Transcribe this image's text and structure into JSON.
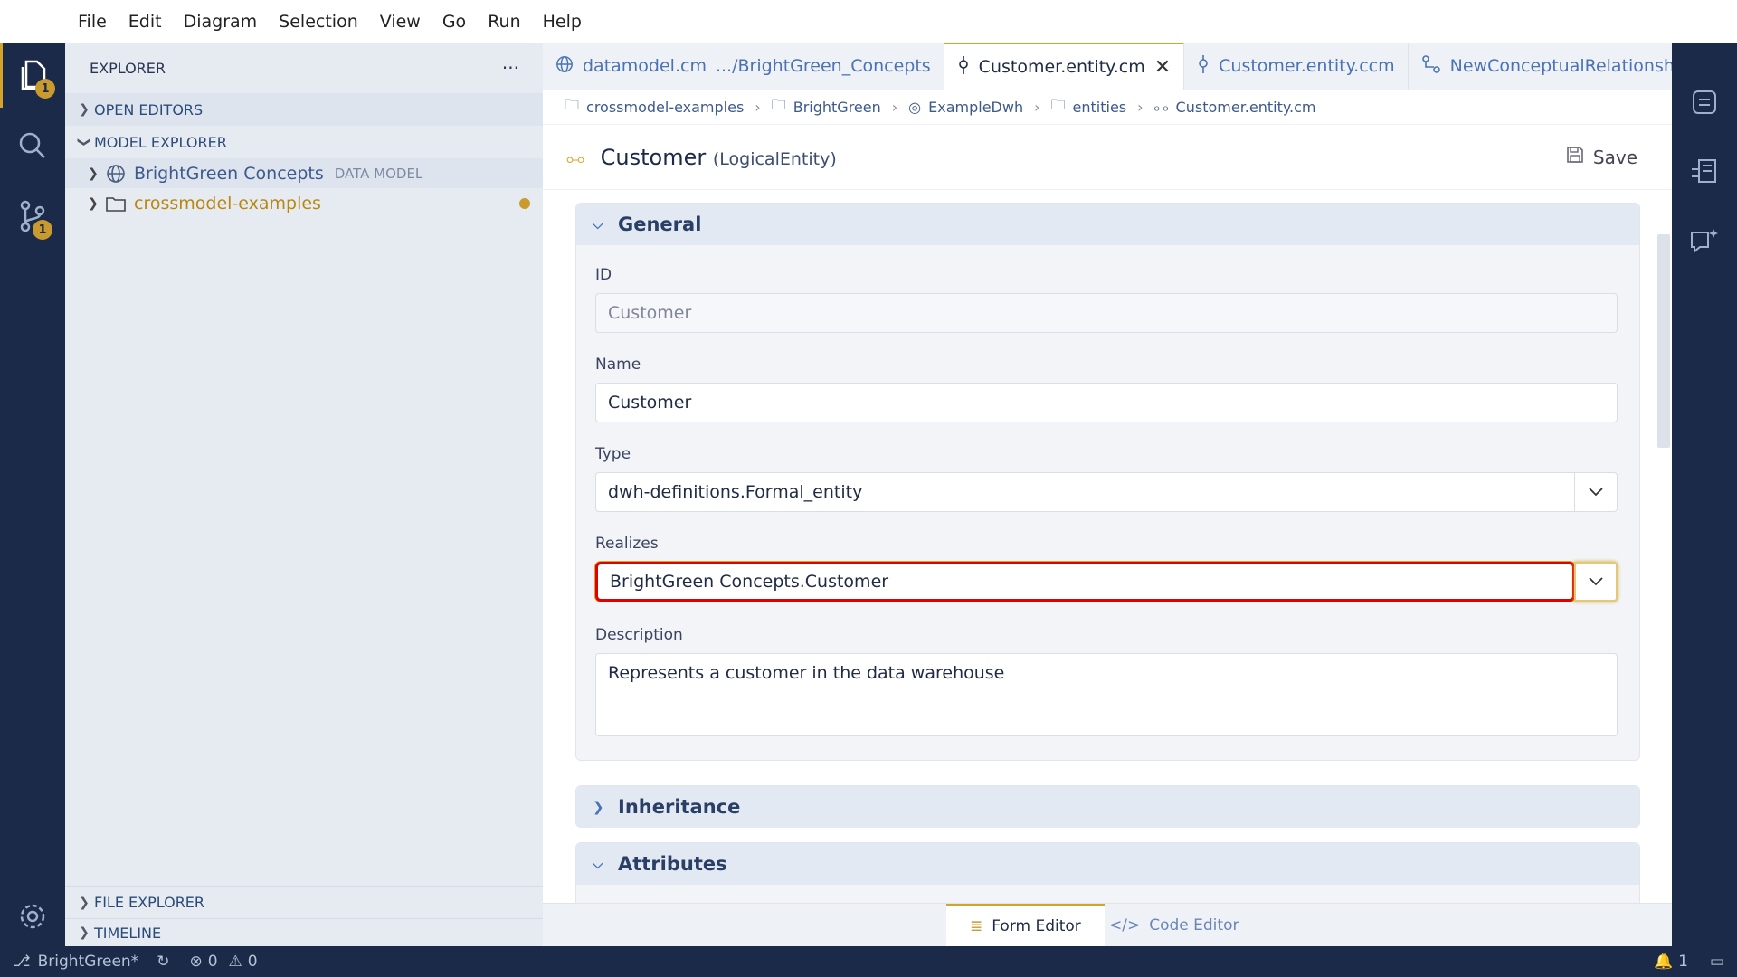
{
  "menu": [
    "File",
    "Edit",
    "Diagram",
    "Selection",
    "View",
    "Go",
    "Run",
    "Help"
  ],
  "activity": {
    "explorer_badge": "1",
    "scm_badge": "1"
  },
  "sidebar": {
    "title": "EXPLORER",
    "more": "···",
    "open_editors": "OPEN EDITORS",
    "model_explorer": "MODEL EXPLORER",
    "tree": [
      {
        "label": "BrightGreen Concepts",
        "tag": "DATA MODEL"
      },
      {
        "label": "crossmodel-examples"
      }
    ],
    "file_explorer": "FILE EXPLORER",
    "timeline": "TIMELINE"
  },
  "tabs": [
    {
      "label": "datamodel.cm",
      "desc": ".../BrightGreen_Concepts"
    },
    {
      "label": "Customer.entity.cm"
    },
    {
      "label": "Customer.entity.ccm"
    },
    {
      "label": "NewConceptualRelationsh"
    }
  ],
  "breadcrumb": [
    "crossmodel-examples",
    "BrightGreen",
    "ExampleDwh",
    "entities",
    "Customer.entity.cm"
  ],
  "form": {
    "title": "Customer",
    "subtitle": "(LogicalEntity)",
    "save": "Save",
    "general": "General",
    "id_label": "ID",
    "id_value": "Customer",
    "name_label": "Name",
    "name_value": "Customer",
    "type_label": "Type",
    "type_value": "dwh-definitions.Formal_entity",
    "realizes_label": "Realizes",
    "realizes_value": "BrightGreen Concepts.Customer",
    "desc_label": "Description",
    "desc_value": "Represents a customer in the data warehouse",
    "inheritance": "Inheritance",
    "attributes": "Attributes"
  },
  "bottom_tabs": {
    "form": "Form Editor",
    "code": "Code Editor"
  },
  "status": {
    "branch": "BrightGreen*",
    "errors": "0",
    "warnings": "0",
    "notifications": "1"
  },
  "colors": {
    "accent": "#d4a42a",
    "nav": "#1b2a48",
    "highlight": "#e00000"
  }
}
